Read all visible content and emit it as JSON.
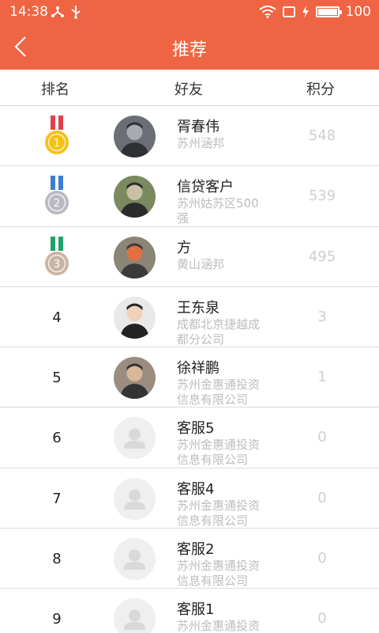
{
  "status_bar": {
    "time": "14:38",
    "battery_level": "100",
    "battery_fraction": 1.0
  },
  "app_bar": {
    "title": "推荐"
  },
  "columns": {
    "rank": "排名",
    "friend": "好友",
    "score": "积分"
  },
  "rows": [
    {
      "rank": "1",
      "medal": "gold",
      "name": "胥春伟",
      "company": "苏州涵邦",
      "score": "548",
      "avatar": "photo"
    },
    {
      "rank": "2",
      "medal": "silver",
      "name": "信贷客户",
      "company": "苏州姑苏区500强",
      "score": "539",
      "avatar": "photo"
    },
    {
      "rank": "3",
      "medal": "bronze",
      "name": "方",
      "company": "黄山涵邦",
      "score": "495",
      "avatar": "photo"
    },
    {
      "rank": "4",
      "medal": "",
      "name": "王东泉",
      "company": "成都北京捷越成都分公司",
      "score": "3",
      "avatar": "photo"
    },
    {
      "rank": "5",
      "medal": "",
      "name": "徐祥鹏",
      "company": "苏州金惠通投资信息有限公司",
      "score": "1",
      "avatar": "photo"
    },
    {
      "rank": "6",
      "medal": "",
      "name": "客服5",
      "company": "苏州金惠通投资信息有限公司",
      "score": "0",
      "avatar": "default"
    },
    {
      "rank": "7",
      "medal": "",
      "name": "客服4",
      "company": "苏州金惠通投资信息有限公司",
      "score": "0",
      "avatar": "default"
    },
    {
      "rank": "8",
      "medal": "",
      "name": "客服2",
      "company": "苏州金惠通投资信息有限公司",
      "score": "0",
      "avatar": "default"
    },
    {
      "rank": "9",
      "medal": "",
      "name": "客服1",
      "company": "苏州金惠通投资信息有限公司",
      "score": "0",
      "avatar": "default"
    }
  ],
  "colors": {
    "accent": "#ef6443",
    "gold": "#f5c012",
    "silver": "#b9b9c4",
    "bronze": "#c9b4a3",
    "muted_text": "#bdbdbd"
  }
}
